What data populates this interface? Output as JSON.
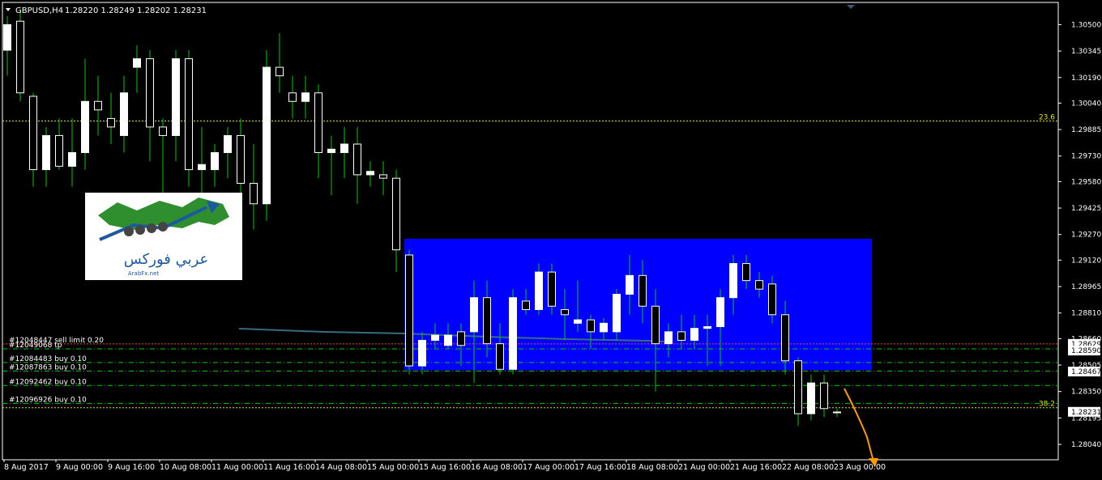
{
  "header": {
    "dropdown_icon": "triangle-down-icon",
    "symbol": "GBPUSD,H4",
    "ohlc": "1.28220 1.28249 1.28202 1.28231"
  },
  "colors": {
    "background": "#000000",
    "axis": "#ffffff",
    "candle_up": "#ffffff",
    "candle_down": "#000000",
    "wick": "#00cc00",
    "zone": "#0000ff",
    "fib_line": "#e6e600",
    "order_line": "#00cc00",
    "ma_line": "#3a6a80",
    "arrow": "#ff9900"
  },
  "logo": {
    "arabic_text": "عربي فوركس",
    "latin_text": "ArabFx.net"
  },
  "chart_data": {
    "type": "candlestick",
    "symbol": "GBPUSD",
    "timeframe": "H4",
    "ylim": [
      1.2795,
      1.3063
    ],
    "y_ticks": [
      "1.30500",
      "1.30345",
      "1.30190",
      "1.30040",
      "1.29885",
      "1.29730",
      "1.29580",
      "1.29425",
      "1.29270",
      "1.29120",
      "1.28965",
      "1.28810",
      "1.28660",
      "1.28505",
      "1.28350",
      "1.28195",
      "1.28040"
    ],
    "x_ticks": [
      "8 Aug 2017",
      "9 Aug 00:00",
      "9 Aug 16:00",
      "10 Aug 08:00",
      "11 Aug 00:00",
      "11 Aug 16:00",
      "14 Aug 08:00",
      "15 Aug 00:00",
      "15 Aug 16:00",
      "16 Aug 08:00",
      "17 Aug 00:00",
      "17 Aug 16:00",
      "18 Aug 08:00",
      "21 Aug 00:00",
      "21 Aug 16:00",
      "22 Aug 08:00",
      "23 Aug 00:00"
    ],
    "price_boxes": [
      "1.28629",
      "1.28590",
      "1.28467",
      "1.28231"
    ],
    "fib_levels": [
      {
        "label": "23.6",
        "price": 1.29935
      },
      {
        "label": "38.2",
        "price": 1.28255
      }
    ],
    "orders": [
      {
        "label": "#12048447 sell limit 0.20",
        "price": 1.28629
      },
      {
        "label": "#12049068 tp",
        "price": 1.286
      },
      {
        "label": "#12084483 buy 0.10",
        "price": 1.2852
      },
      {
        "label": "#12087863 buy 0.10",
        "price": 1.2847
      },
      {
        "label": "#12092462 buy 0.10",
        "price": 1.28385
      },
      {
        "label": "#12096926 buy 0.10",
        "price": 1.2828
      }
    ],
    "zone": {
      "price_top": 1.29245,
      "price_bottom": 1.28475,
      "start_candle": 31,
      "end_candle": 67
    },
    "candles": [
      [
        1.3035,
        1.3055,
        1.302,
        1.305
      ],
      [
        1.3052,
        1.3058,
        1.3005,
        1.301
      ],
      [
        1.3008,
        1.301,
        1.2955,
        1.2965
      ],
      [
        1.2965,
        1.299,
        1.2955,
        1.2985
      ],
      [
        1.2985,
        1.2995,
        1.2965,
        1.2967
      ],
      [
        1.2967,
        1.2995,
        1.2955,
        1.2975
      ],
      [
        1.2975,
        1.303,
        1.2965,
        1.3005
      ],
      [
        1.3005,
        1.302,
        1.2985,
        1.3
      ],
      [
        1.2995,
        1.301,
        1.298,
        1.299
      ],
      [
        1.2985,
        1.302,
        1.2975,
        1.301
      ],
      [
        1.3025,
        1.3038,
        1.301,
        1.303
      ],
      [
        1.303,
        1.3035,
        1.297,
        1.299
      ],
      [
        1.299,
        1.2995,
        1.2945,
        1.2985
      ],
      [
        1.2985,
        1.3035,
        1.297,
        1.303
      ],
      [
        1.303,
        1.3035,
        1.2955,
        1.2965
      ],
      [
        1.2965,
        1.299,
        1.295,
        1.2968
      ],
      [
        1.2965,
        1.298,
        1.2955,
        1.2975
      ],
      [
        1.2975,
        1.299,
        1.296,
        1.2985
      ],
      [
        1.2985,
        1.2995,
        1.295,
        1.2957
      ],
      [
        1.2957,
        1.298,
        1.293,
        1.2945
      ],
      [
        1.2945,
        1.3035,
        1.2935,
        1.3025
      ],
      [
        1.3025,
        1.3045,
        1.301,
        1.302
      ],
      [
        1.301,
        1.302,
        1.2995,
        1.3005
      ],
      [
        1.3005,
        1.302,
        1.2995,
        1.301
      ],
      [
        1.301,
        1.3015,
        1.296,
        1.2975
      ],
      [
        1.2975,
        1.2985,
        1.295,
        1.2977
      ],
      [
        1.2975,
        1.299,
        1.296,
        1.298
      ],
      [
        1.298,
        1.299,
        1.2945,
        1.2962
      ],
      [
        1.2962,
        1.297,
        1.2955,
        1.2964
      ],
      [
        1.2962,
        1.297,
        1.295,
        1.296
      ],
      [
        1.296,
        1.2965,
        1.2905,
        1.2918
      ],
      [
        1.2915,
        1.2918,
        1.2845,
        1.285
      ],
      [
        1.285,
        1.287,
        1.2845,
        1.2865
      ],
      [
        1.2865,
        1.2875,
        1.286,
        1.2868
      ],
      [
        1.2862,
        1.2875,
        1.286,
        1.2868
      ],
      [
        1.287,
        1.2875,
        1.285,
        1.2862
      ],
      [
        1.287,
        1.29,
        1.284,
        1.289
      ],
      [
        1.289,
        1.29,
        1.2855,
        1.2863
      ],
      [
        1.2863,
        1.2875,
        1.2845,
        1.2848
      ],
      [
        1.2848,
        1.2895,
        1.2845,
        1.289
      ],
      [
        1.2888,
        1.2895,
        1.288,
        1.2883
      ],
      [
        1.2883,
        1.291,
        1.288,
        1.2905
      ],
      [
        1.2905,
        1.291,
        1.288,
        1.2885
      ],
      [
        1.2883,
        1.2895,
        1.2865,
        1.288
      ],
      [
        1.2875,
        1.29,
        1.287,
        1.2877
      ],
      [
        1.2877,
        1.288,
        1.286,
        1.287
      ],
      [
        1.287,
        1.2878,
        1.2865,
        1.2875
      ],
      [
        1.287,
        1.2895,
        1.2865,
        1.2892
      ],
      [
        1.2892,
        1.2915,
        1.288,
        1.2903
      ],
      [
        1.2903,
        1.2912,
        1.2875,
        1.2885
      ],
      [
        1.2885,
        1.2895,
        1.2835,
        1.2863
      ],
      [
        1.2863,
        1.2875,
        1.2855,
        1.287
      ],
      [
        1.287,
        1.288,
        1.286,
        1.2865
      ],
      [
        1.2865,
        1.288,
        1.286,
        1.2872
      ],
      [
        1.2872,
        1.288,
        1.285,
        1.2873
      ],
      [
        1.2873,
        1.2895,
        1.285,
        1.289
      ],
      [
        1.289,
        1.2915,
        1.288,
        1.291
      ],
      [
        1.291,
        1.2915,
        1.2895,
        1.29
      ],
      [
        1.29,
        1.2905,
        1.289,
        1.2895
      ],
      [
        1.2898,
        1.2903,
        1.2875,
        1.288
      ],
      [
        1.288,
        1.2888,
        1.2845,
        1.2853
      ],
      [
        1.2853,
        1.2855,
        1.2815,
        1.2822
      ],
      [
        1.2822,
        1.2845,
        1.2818,
        1.284
      ],
      [
        1.284,
        1.2845,
        1.282,
        1.2825
      ],
      [
        1.2823,
        1.2825,
        1.282,
        1.2823
      ]
    ]
  }
}
